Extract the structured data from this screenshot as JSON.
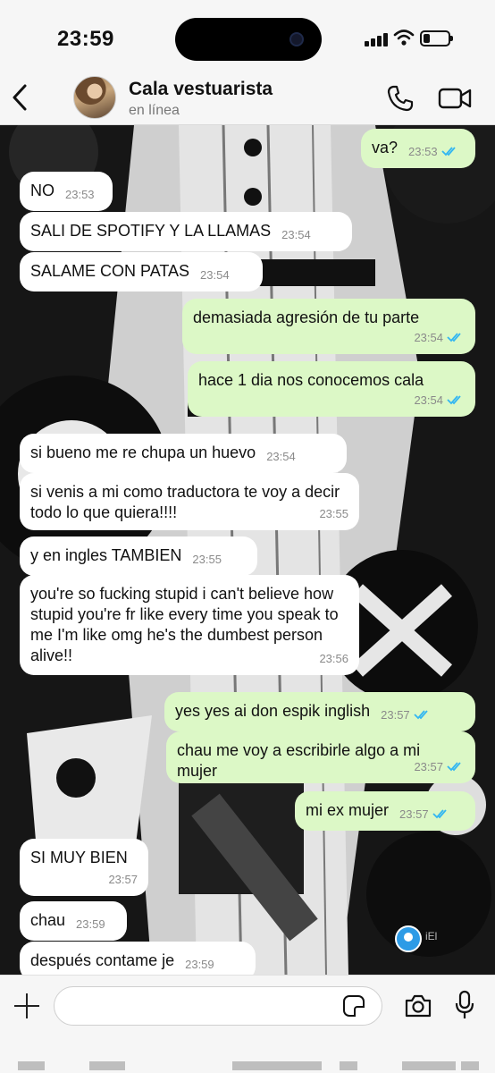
{
  "status_bar": {
    "time": "23:59",
    "battery_level": 0.25
  },
  "header": {
    "contact_name": "Cala vestuarista",
    "contact_status": "en línea",
    "icons": [
      "chevron-left-icon",
      "avatar",
      "phone-icon",
      "video-camera-icon"
    ]
  },
  "messages": [
    {
      "dir": "out",
      "text": "va?",
      "time": "23:53",
      "read": true
    },
    {
      "dir": "in",
      "text": "NO",
      "time": "23:53"
    },
    {
      "dir": "in",
      "text": "SALI DE SPOTIFY Y LA LLAMAS",
      "time": "23:54"
    },
    {
      "dir": "in",
      "text": "SALAME CON PATAS",
      "time": "23:54"
    },
    {
      "dir": "out",
      "text": "demasiada agresión de tu parte",
      "time": "23:54",
      "read": true
    },
    {
      "dir": "out",
      "text": "hace 1 dia nos conocemos cala",
      "time": "23:54",
      "read": true
    },
    {
      "dir": "in",
      "text": "si bueno me re chupa un huevo",
      "time": "23:54"
    },
    {
      "dir": "in",
      "text": "si venis a mi como traductora te voy a decir todo lo que quiera!!!!",
      "time": "23:55"
    },
    {
      "dir": "in",
      "text": "y en ingles TAMBIEN",
      "time": "23:55"
    },
    {
      "dir": "in",
      "text": "you're so fucking stupid i can't believe how stupid you're fr like every time you speak to me I'm like omg he's the dumbest person alive!!",
      "time": "23:56"
    },
    {
      "dir": "out",
      "text": "yes yes ai don espik inglish",
      "time": "23:57",
      "read": true
    },
    {
      "dir": "out",
      "text": "chau me voy a escribirle algo a mi mujer",
      "time": "23:57",
      "read": true
    },
    {
      "dir": "out",
      "text": "mi ex mujer",
      "time": "23:57",
      "read": true
    },
    {
      "dir": "in",
      "text": "SI MUY BIEN",
      "time": "23:57"
    },
    {
      "dir": "in",
      "text": "chau",
      "time": "23:59"
    },
    {
      "dir": "in",
      "text": "después contame je",
      "time": "23:59"
    }
  ],
  "overlay": {
    "watermark": "iEl"
  },
  "input": {
    "placeholder": "",
    "value": ""
  },
  "colors": {
    "bubble_in": "#ffffff",
    "bubble_out": "#dcf8c6",
    "read_ticks": "#34b7f1",
    "chat_bg": "#1a1a1a"
  }
}
